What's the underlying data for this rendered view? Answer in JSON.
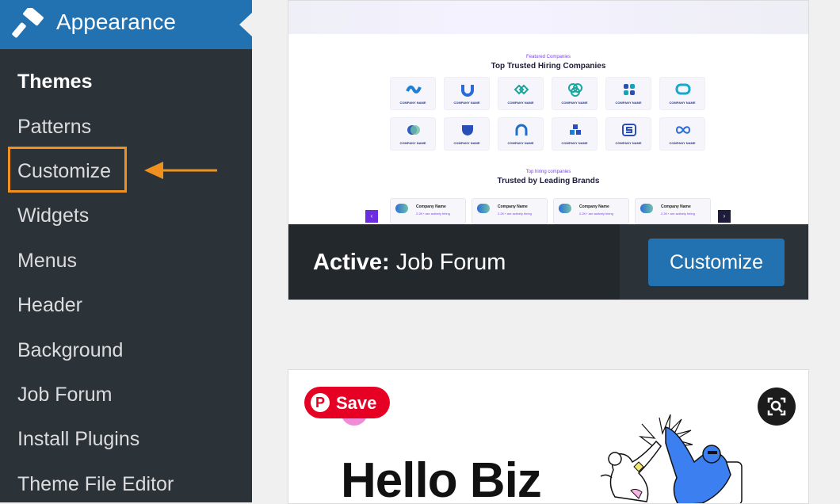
{
  "sidebar": {
    "menu_label": "Appearance",
    "menu_icon": "paintbrush-icon",
    "items": [
      "Themes",
      "Patterns",
      "Customize",
      "Widgets",
      "Menus",
      "Header",
      "Background",
      "Job Forum",
      "Install Plugins",
      "Theme File Editor"
    ],
    "current_item": "Themes",
    "highlighted_item": "Customize",
    "accent_color": "#2271b1",
    "highlight_color": "#f0901e"
  },
  "active_theme": {
    "preview": {
      "kicker1": "Featured Companies",
      "heading1": "Top Trusted Hiring Companies",
      "logo_label": "COMPANY NAME",
      "kicker2": "Top hiring companies",
      "heading2": "Trusted by Leading Brands",
      "brand_name": "Company Name",
      "brand_sub": "2.2K+ are actively hiring"
    },
    "active_prefix": "Active:",
    "theme_name": "Job Forum",
    "customize_label": "Customize"
  },
  "next_theme": {
    "title": "Hello Biz",
    "pin_label": "Save",
    "pin_icon": "pinterest-icon",
    "lens_icon": "visual-search-icon"
  }
}
